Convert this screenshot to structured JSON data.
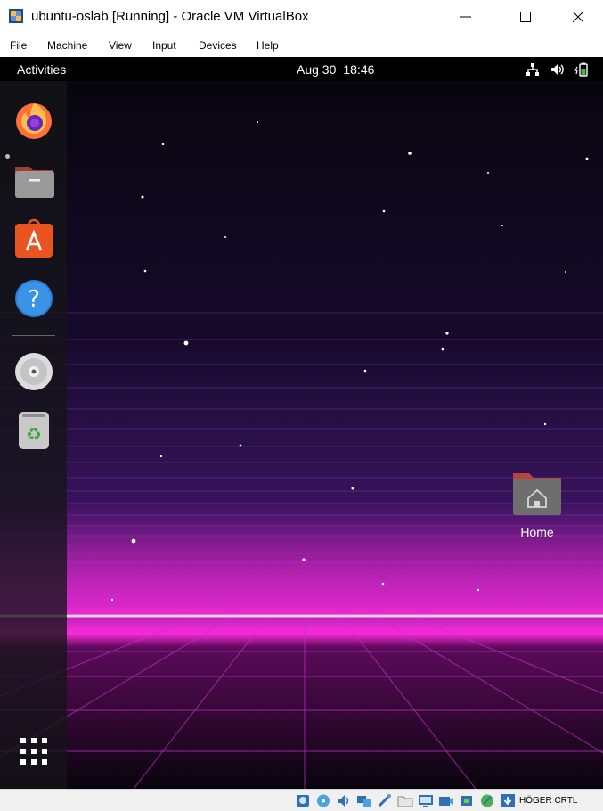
{
  "window": {
    "title": "ubuntu-oslab [Running] - Oracle VM VirtualBox",
    "app_icon": "virtualbox-icon"
  },
  "menu": {
    "items": [
      {
        "label": "File"
      },
      {
        "label": "Machine"
      },
      {
        "label": "View"
      },
      {
        "label": "Input"
      },
      {
        "label": "Devices"
      },
      {
        "label": "Help"
      }
    ]
  },
  "guest": {
    "topbar": {
      "activities": "Activities",
      "date": "Aug 30",
      "time": "18:46",
      "tray_icons": [
        "network-icon",
        "volume-icon",
        "battery-icon"
      ]
    },
    "dock": {
      "items": [
        {
          "name": "firefox-icon"
        },
        {
          "name": "files-icon"
        },
        {
          "name": "app-center-icon"
        },
        {
          "name": "help-icon"
        },
        {
          "name": "cd-drive-icon"
        },
        {
          "name": "trash-icon"
        },
        {
          "name": "show-apps-icon"
        }
      ]
    },
    "desktop": {
      "home_label": "Home"
    }
  },
  "statusbar": {
    "icons": [
      "hard-disk-icon",
      "optical-drive-icon",
      "audio-icon",
      "network-icon",
      "usb-icon",
      "shared-folders-icon",
      "display-icon",
      "recording-icon",
      "cpu-icon",
      "mouse-integration-icon",
      "keyboard-icon"
    ],
    "host_key": "HÖGER CRTL"
  },
  "colors": {
    "accent_magenta": "#ff2bdc",
    "ubuntu_orange": "#e95420",
    "dock_bg": "#141418"
  }
}
